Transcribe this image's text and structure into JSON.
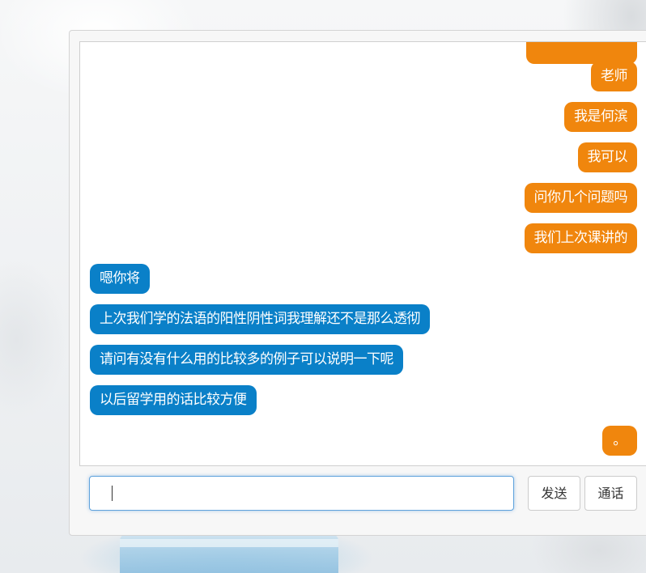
{
  "messages": [
    {
      "side": "me",
      "text": ""
    },
    {
      "side": "me",
      "text": "老师"
    },
    {
      "side": "me",
      "text": "我是何滨"
    },
    {
      "side": "me",
      "text": "我可以"
    },
    {
      "side": "me",
      "text": "问你几个问题吗"
    },
    {
      "side": "me",
      "text": "我们上次课讲的"
    },
    {
      "side": "peer",
      "text": "嗯你将"
    },
    {
      "side": "peer",
      "text": "上次我们学的法语的阳性阴性词我理解还不是那么透彻"
    },
    {
      "side": "peer",
      "text": "请问有没有什么用的比较多的例子可以说明一下呢"
    },
    {
      "side": "peer",
      "text": "以后留学用的话比较方便"
    },
    {
      "side": "me",
      "text": "。"
    }
  ],
  "composer": {
    "input_value": "",
    "send_label": "发送",
    "call_label": "通话"
  },
  "colors": {
    "outgoing_bubble": "#f0860d",
    "incoming_bubble": "#0a80c8",
    "input_focus_border": "#5fa2dc"
  }
}
